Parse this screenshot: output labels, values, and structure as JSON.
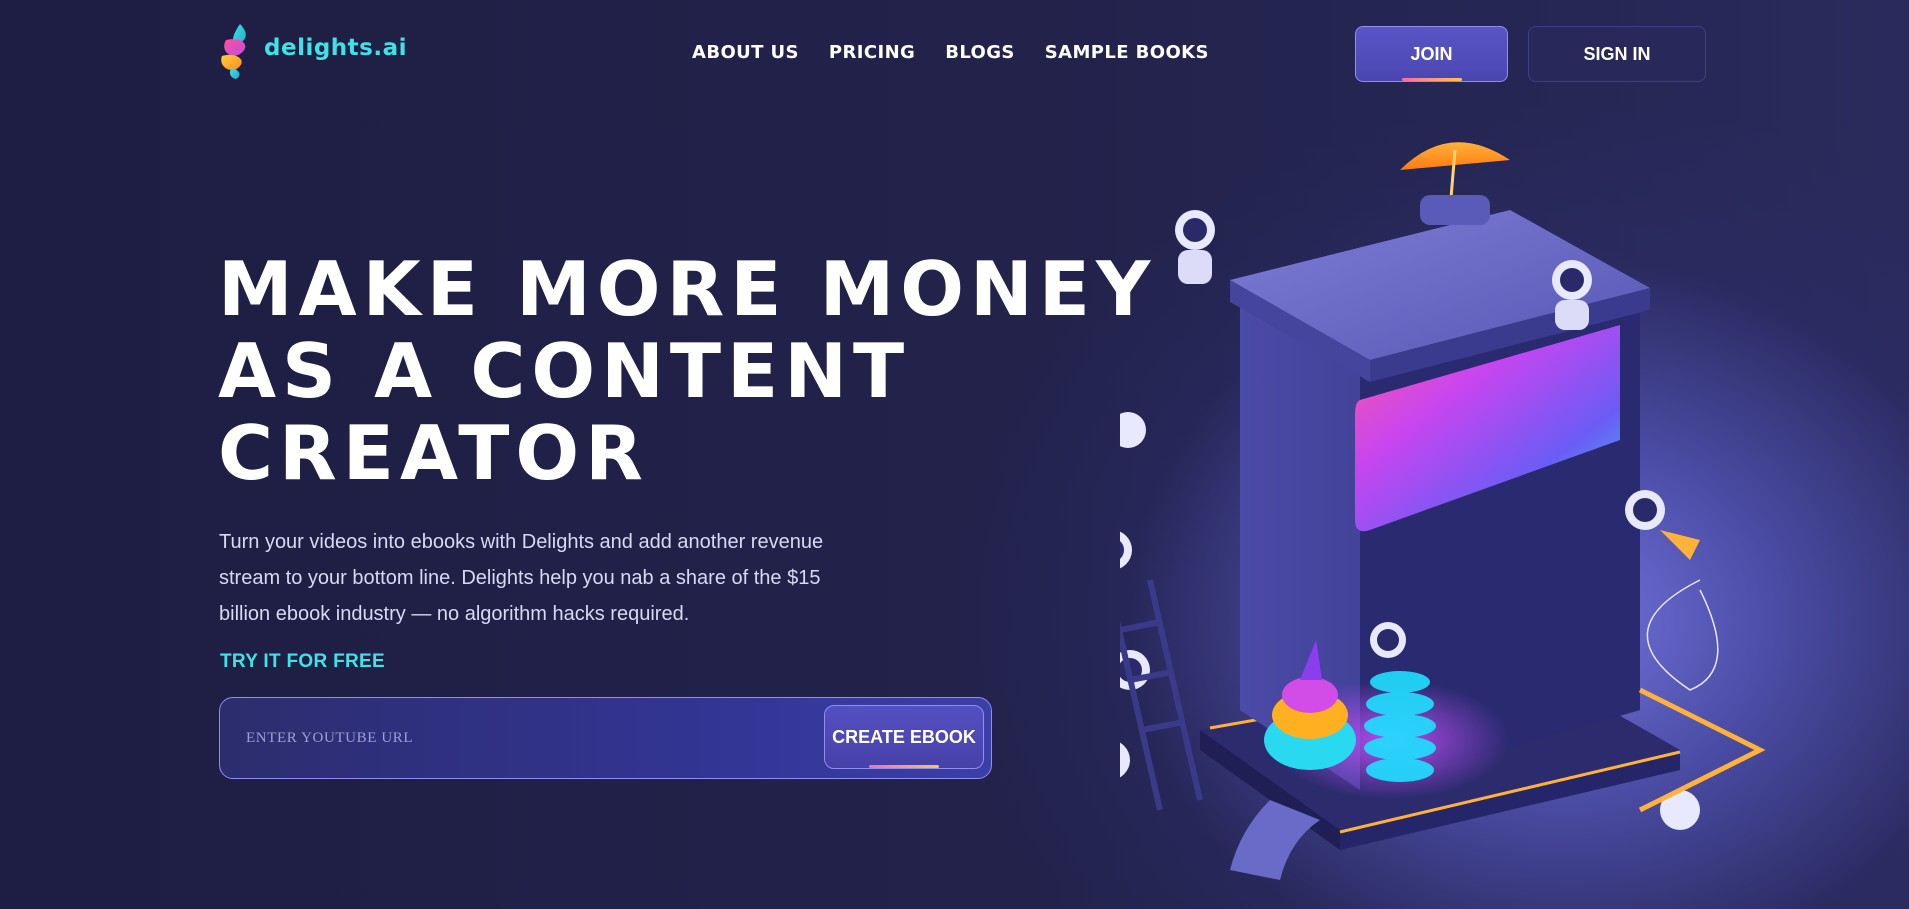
{
  "header": {
    "logo_text": "delights.ai",
    "nav": [
      {
        "label": "ABOUT US"
      },
      {
        "label": "PRICING"
      },
      {
        "label": "BLOGS"
      },
      {
        "label": "SAMPLE BOOKS"
      }
    ],
    "join_label": "JOIN",
    "signin_label": "SIGN IN"
  },
  "hero": {
    "title_lines": [
      "MAKE MORE MONEY",
      "AS A CONTENT",
      "CREATOR"
    ],
    "description": "Turn your videos into ebooks with Delights and add another revenue stream to your bottom line. Delights help you nab a share of the $15 billion ebook industry — no algorithm hacks required.",
    "try_label": "TRY IT FOR FREE",
    "url_placeholder": "ENTER YOUTUBE URL",
    "url_value": "",
    "create_label": "CREATE EBOOK"
  },
  "colors": {
    "background": "#1f1f45",
    "accent_cyan": "#3fe3e6",
    "button": "#4a46b0",
    "glow": "#7a7ae6"
  },
  "icons": {
    "logo": "delights-logo-icon",
    "illustration": "ebook-machine-illustration"
  }
}
